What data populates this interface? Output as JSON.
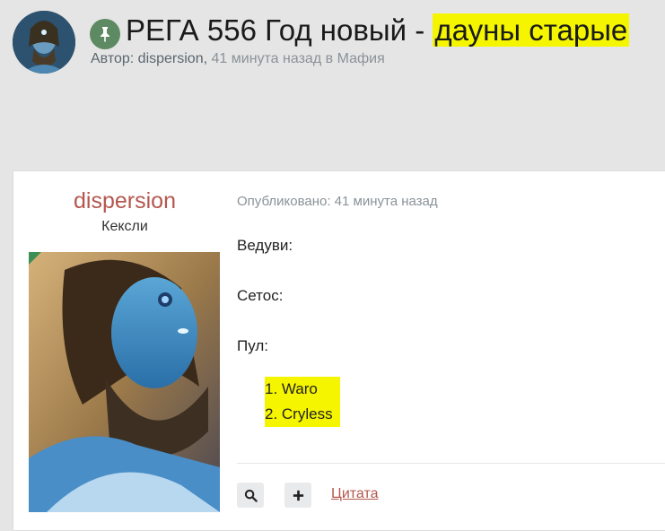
{
  "topic": {
    "title_prefix": "РЕГА 556 Год новый - ",
    "title_highlight": "дауны старые",
    "byline_label": "Автор:",
    "author": "dispersion",
    "separator": ",",
    "time_ago": "41 минута назад",
    "in_label": "в",
    "forum": "Мафия"
  },
  "post": {
    "author_name": "dispersion",
    "author_rank": "Кексли",
    "published": "Опубликовано: 41 минута назад",
    "lines": {
      "host": "Ведуви:",
      "setos": "Сетос:",
      "pool": "Пул:"
    },
    "pool_items": [
      "1. Waro",
      "2. Cryless"
    ],
    "actions": {
      "search_icon": "search-icon",
      "add_icon": "plus-icon",
      "quote_label": "Цитата"
    }
  },
  "colors": {
    "highlight": "#f5f500",
    "author_link": "#b4574e",
    "pin_badge": "#5d8a63",
    "online_indicator": "#3e8f56"
  }
}
